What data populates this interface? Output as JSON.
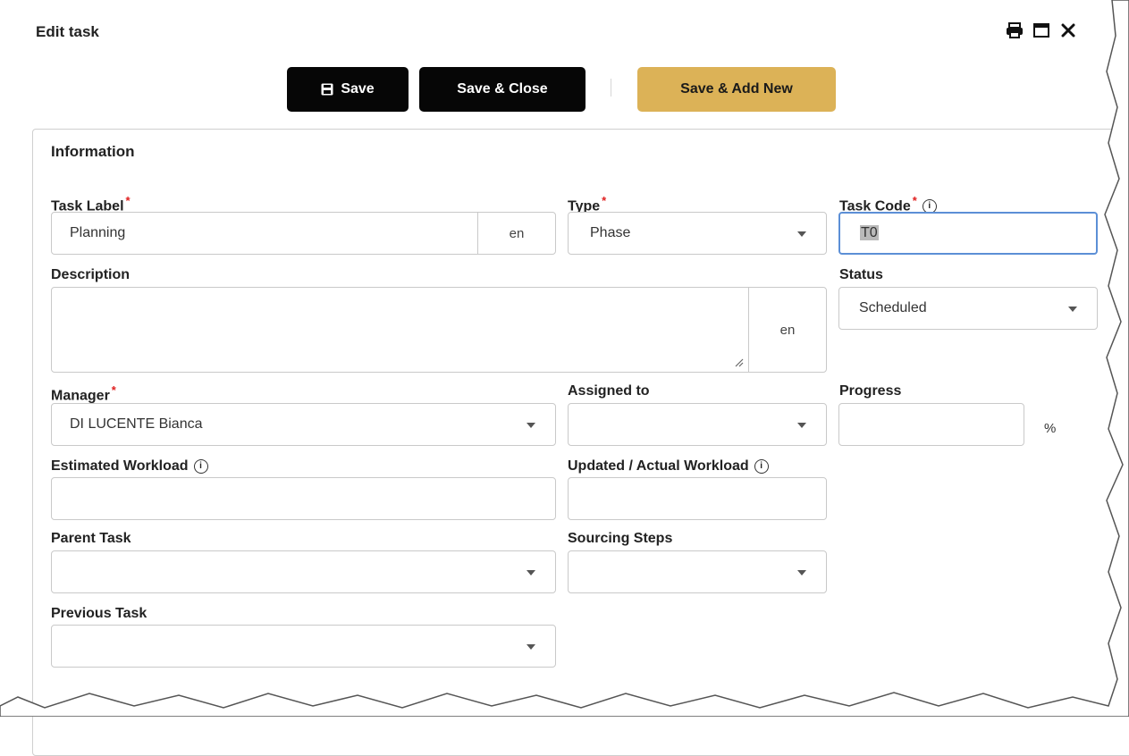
{
  "window": {
    "title": "Edit task",
    "icons": [
      "print-icon",
      "maximize-icon",
      "close-icon"
    ]
  },
  "toolbar": {
    "save_label": "Save",
    "save_close_label": "Save & Close",
    "save_add_new_label": "Save & Add New",
    "accent_color": "#dcb257"
  },
  "section": {
    "title": "Information"
  },
  "fields": {
    "task_label": {
      "label": "Task Label",
      "value": "Planning",
      "lang": "en",
      "required": true
    },
    "type": {
      "label": "Type",
      "value": "Phase",
      "required": true
    },
    "task_code": {
      "label": "Task Code",
      "value": "T0",
      "required": true
    },
    "description": {
      "label": "Description",
      "value": "",
      "lang": "en"
    },
    "status": {
      "label": "Status",
      "value": "Scheduled"
    },
    "manager": {
      "label": "Manager",
      "value": "DI LUCENTE Bianca",
      "required": true
    },
    "assigned_to": {
      "label": "Assigned to",
      "value": ""
    },
    "progress": {
      "label": "Progress",
      "value": "",
      "unit": "%"
    },
    "estimated_workload": {
      "label": "Estimated Workload",
      "value": ""
    },
    "actual_workload": {
      "label": "Updated / Actual Workload",
      "value": ""
    },
    "parent_task": {
      "label": "Parent Task",
      "value": ""
    },
    "sourcing_steps": {
      "label": "Sourcing Steps",
      "value": ""
    },
    "previous_task": {
      "label": "Previous Task",
      "value": ""
    }
  }
}
